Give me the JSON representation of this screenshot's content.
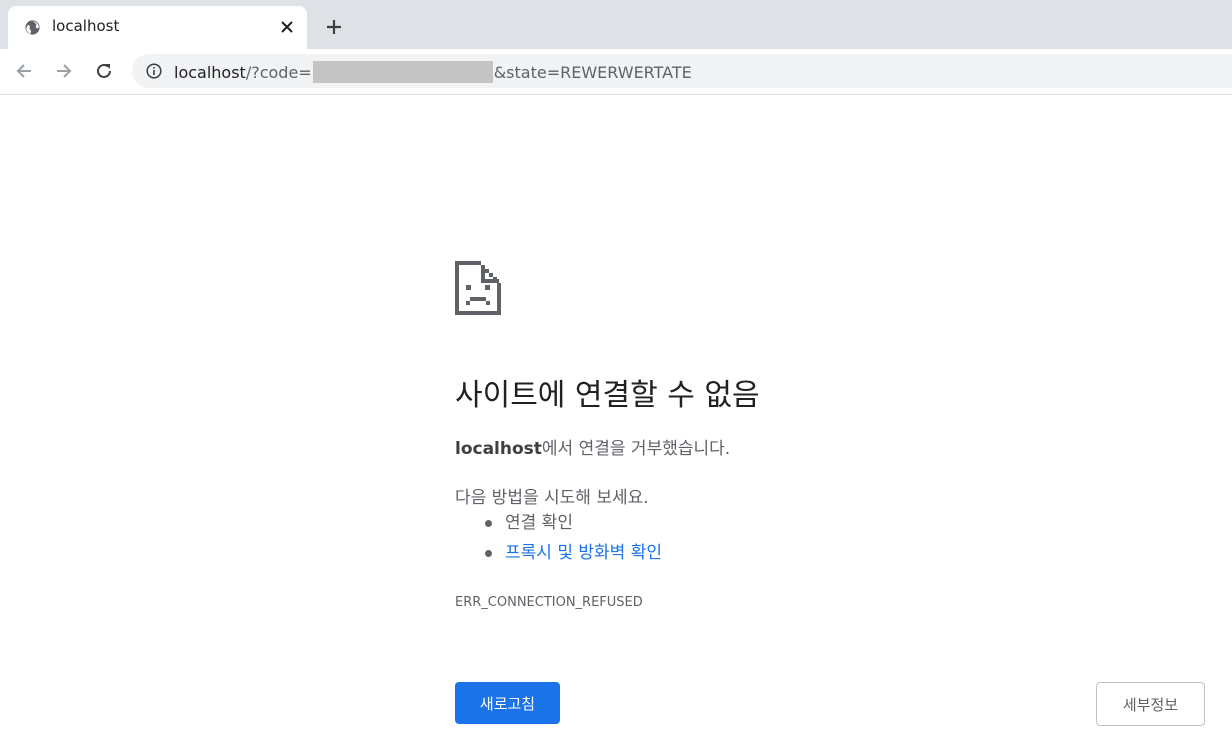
{
  "browser": {
    "tab": {
      "title": "localhost",
      "favicon": "globe-icon"
    },
    "address": {
      "host": "localhost",
      "path_prefix": "/?code=",
      "path_suffix": "&state=REWERWERTATE"
    }
  },
  "error_page": {
    "icon": "sad-document-icon",
    "heading": "사이트에 연결할 수 없음",
    "summary_host": "localhost",
    "summary_rest": "에서 연결을 거부했습니다.",
    "suggest_intro": "다음 방법을 시도해 보세요.",
    "suggestions": [
      "연결 확인",
      "프록시 및 방화벽 확인"
    ],
    "error_code": "ERR_CONNECTION_REFUSED",
    "reload_label": "새로고침",
    "details_label": "세부정보"
  },
  "colors": {
    "accent": "#1a73e8",
    "text_primary": "#202124",
    "text_secondary": "#5f6368",
    "tabstrip": "#dee1e6"
  }
}
